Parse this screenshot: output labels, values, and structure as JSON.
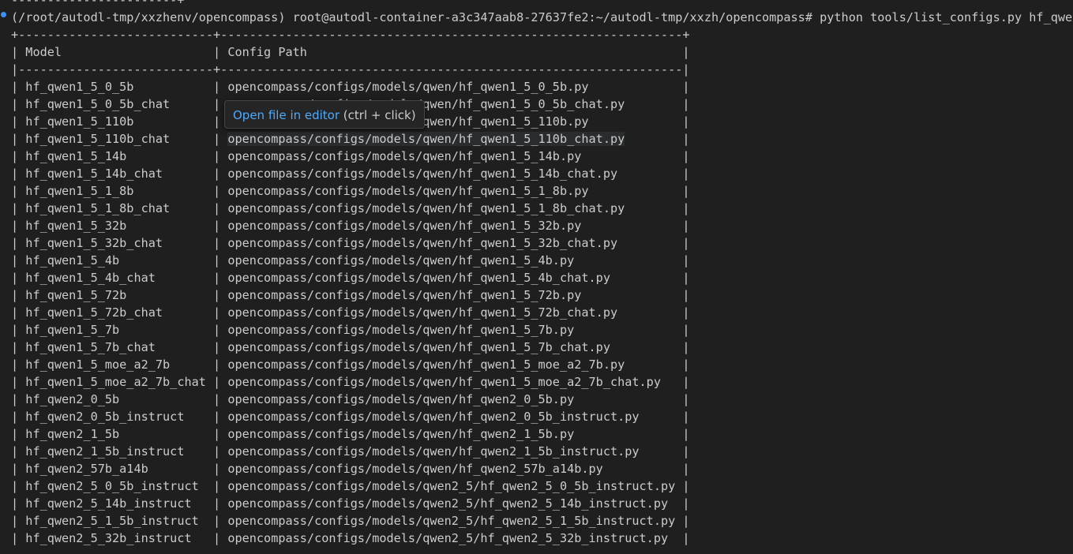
{
  "terminal": {
    "prompt_env": "(/root/autodl-tmp/xxzhenv/opencompass)",
    "prompt_user": "root@autodl-container-a3c347aab8-27637fe2:~/autodl-tmp/xxzh/opencompass#",
    "command": "python tools/list_configs.py hf_qwen",
    "top_border_fragment": "-----------------------+",
    "border_top": "+---------------------------+----------------------------------------------------------------+",
    "border_mid": "|---------------------------+----------------------------------------------------------------|",
    "headers": {
      "model": "Model",
      "path": "Config Path"
    },
    "rows": [
      {
        "model": "hf_qwen1_5_0_5b",
        "path": "opencompass/configs/models/qwen/hf_qwen1_5_0_5b.py"
      },
      {
        "model": "hf_qwen1_5_0_5b_chat",
        "path": "opencompass/configs/models/qwen/hf_qwen1_5_0_5b_chat.py"
      },
      {
        "model": "hf_qwen1_5_110b",
        "path": "opencompass/configs/models/qwen/hf_qwen1_5_110b.py"
      },
      {
        "model": "hf_qwen1_5_110b_chat",
        "path": "opencompass/configs/models/qwen/hf_qwen1_5_110b_chat.py"
      },
      {
        "model": "hf_qwen1_5_14b",
        "path": "opencompass/configs/models/qwen/hf_qwen1_5_14b.py"
      },
      {
        "model": "hf_qwen1_5_14b_chat",
        "path": "opencompass/configs/models/qwen/hf_qwen1_5_14b_chat.py"
      },
      {
        "model": "hf_qwen1_5_1_8b",
        "path": "opencompass/configs/models/qwen/hf_qwen1_5_1_8b.py"
      },
      {
        "model": "hf_qwen1_5_1_8b_chat",
        "path": "opencompass/configs/models/qwen/hf_qwen1_5_1_8b_chat.py"
      },
      {
        "model": "hf_qwen1_5_32b",
        "path": "opencompass/configs/models/qwen/hf_qwen1_5_32b.py"
      },
      {
        "model": "hf_qwen1_5_32b_chat",
        "path": "opencompass/configs/models/qwen/hf_qwen1_5_32b_chat.py"
      },
      {
        "model": "hf_qwen1_5_4b",
        "path": "opencompass/configs/models/qwen/hf_qwen1_5_4b.py"
      },
      {
        "model": "hf_qwen1_5_4b_chat",
        "path": "opencompass/configs/models/qwen/hf_qwen1_5_4b_chat.py"
      },
      {
        "model": "hf_qwen1_5_72b",
        "path": "opencompass/configs/models/qwen/hf_qwen1_5_72b.py"
      },
      {
        "model": "hf_qwen1_5_72b_chat",
        "path": "opencompass/configs/models/qwen/hf_qwen1_5_72b_chat.py"
      },
      {
        "model": "hf_qwen1_5_7b",
        "path": "opencompass/configs/models/qwen/hf_qwen1_5_7b.py"
      },
      {
        "model": "hf_qwen1_5_7b_chat",
        "path": "opencompass/configs/models/qwen/hf_qwen1_5_7b_chat.py"
      },
      {
        "model": "hf_qwen1_5_moe_a2_7b",
        "path": "opencompass/configs/models/qwen/hf_qwen1_5_moe_a2_7b.py"
      },
      {
        "model": "hf_qwen1_5_moe_a2_7b_chat",
        "path": "opencompass/configs/models/qwen/hf_qwen1_5_moe_a2_7b_chat.py"
      },
      {
        "model": "hf_qwen2_0_5b",
        "path": "opencompass/configs/models/qwen/hf_qwen2_0_5b.py"
      },
      {
        "model": "hf_qwen2_0_5b_instruct",
        "path": "opencompass/configs/models/qwen/hf_qwen2_0_5b_instruct.py"
      },
      {
        "model": "hf_qwen2_1_5b",
        "path": "opencompass/configs/models/qwen/hf_qwen2_1_5b.py"
      },
      {
        "model": "hf_qwen2_1_5b_instruct",
        "path": "opencompass/configs/models/qwen/hf_qwen2_1_5b_instruct.py"
      },
      {
        "model": "hf_qwen2_57b_a14b",
        "path": "opencompass/configs/models/qwen/hf_qwen2_57b_a14b.py"
      },
      {
        "model": "hf_qwen2_5_0_5b_instruct",
        "path": "opencompass/configs/models/qwen2_5/hf_qwen2_5_0_5b_instruct.py"
      },
      {
        "model": "hf_qwen2_5_14b_instruct",
        "path": "opencompass/configs/models/qwen2_5/hf_qwen2_5_14b_instruct.py"
      },
      {
        "model": "hf_qwen2_5_1_5b_instruct",
        "path": "opencompass/configs/models/qwen2_5/hf_qwen2_5_1_5b_instruct.py"
      },
      {
        "model": "hf_qwen2_5_32b_instruct",
        "path": "opencompass/configs/models/qwen2_5/hf_qwen2_5_32b_instruct.py"
      }
    ],
    "hovered_row_index": 3
  },
  "tooltip": {
    "link_text": "Open file in editor",
    "hint_text": " (ctrl + click)"
  },
  "colors": {
    "background": "#1f1f1f",
    "text": "#cccccc",
    "accent": "#3794ff",
    "link": "#4daafc"
  }
}
